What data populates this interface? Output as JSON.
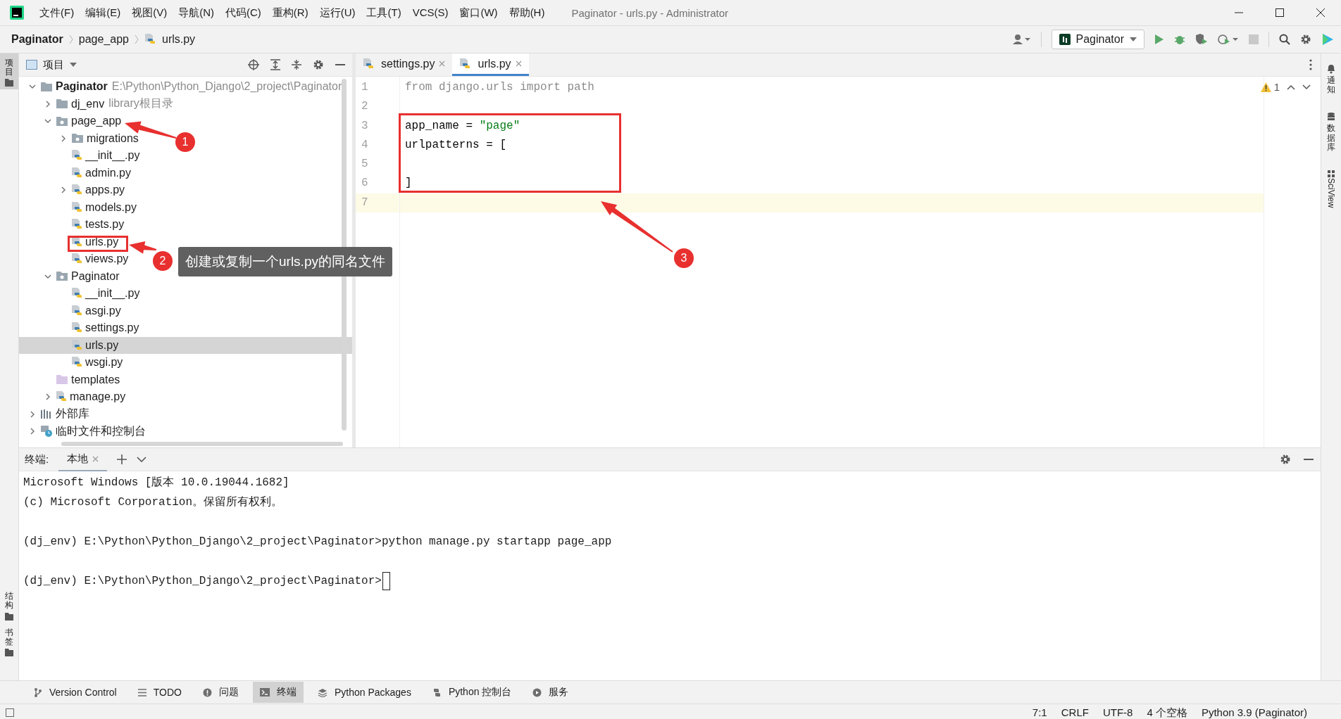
{
  "window": {
    "title": "Paginator - urls.py - Administrator"
  },
  "menu": [
    "文件(F)",
    "编辑(E)",
    "视图(V)",
    "导航(N)",
    "代码(C)",
    "重构(R)",
    "运行(U)",
    "工具(T)",
    "VCS(S)",
    "窗口(W)",
    "帮助(H)"
  ],
  "breadcrumb": [
    {
      "label": "Paginator",
      "kind": "project"
    },
    {
      "label": "page_app",
      "kind": "folder"
    },
    {
      "label": "urls.py",
      "kind": "python"
    }
  ],
  "run_config": {
    "label": "Paginator"
  },
  "left_stripe": [
    {
      "label": "项目",
      "kind": "top",
      "selected": true
    },
    {
      "label": "结构",
      "kind": "bottom",
      "selected": false
    },
    {
      "label": "书签",
      "kind": "bottom",
      "selected": false
    }
  ],
  "right_stripe": [
    {
      "label": "通知",
      "kind": "bell"
    },
    {
      "label": "数据库",
      "kind": "database"
    },
    {
      "label": "SciView",
      "kind": "grid"
    }
  ],
  "project_panel": {
    "title": "项目",
    "tree": [
      {
        "label": "Paginator",
        "kind": "project",
        "hint": "E:\\Python\\Python_Django\\2_project\\Paginator",
        "expanded": true,
        "selected": false,
        "children": [
          {
            "label": "dj_env",
            "kind": "folder",
            "hint": "library根目录",
            "expanded": false,
            "selected": false
          },
          {
            "label": "page_app",
            "kind": "package",
            "expanded": true,
            "selected": false,
            "children": [
              {
                "label": "migrations",
                "kind": "package",
                "expanded": false,
                "selected": false
              },
              {
                "label": "__init__.py",
                "kind": "python",
                "selected": false
              },
              {
                "label": "admin.py",
                "kind": "python",
                "selected": false
              },
              {
                "label": "apps.py",
                "kind": "python",
                "expanded": false,
                "selected": false
              },
              {
                "label": "models.py",
                "kind": "python",
                "selected": false
              },
              {
                "label": "tests.py",
                "kind": "python",
                "selected": false
              },
              {
                "label": "urls.py",
                "kind": "python",
                "selected": false
              },
              {
                "label": "views.py",
                "kind": "python",
                "selected": false
              }
            ]
          },
          {
            "label": "Paginator",
            "kind": "package",
            "expanded": true,
            "selected": false,
            "children": [
              {
                "label": "__init__.py",
                "kind": "python",
                "selected": false
              },
              {
                "label": "asgi.py",
                "kind": "python",
                "selected": false
              },
              {
                "label": "settings.py",
                "kind": "python",
                "selected": false
              },
              {
                "label": "urls.py",
                "kind": "python",
                "selected": true
              },
              {
                "label": "wsgi.py",
                "kind": "python",
                "selected": false
              }
            ]
          },
          {
            "label": "templates",
            "kind": "templates",
            "selected": false
          },
          {
            "label": "manage.py",
            "kind": "python",
            "expanded": false,
            "selected": false
          }
        ]
      },
      {
        "label": "外部库",
        "kind": "library",
        "expanded": false,
        "selected": false
      },
      {
        "label": "临时文件和控制台",
        "kind": "scratch",
        "expanded": false,
        "selected": false
      }
    ]
  },
  "editor": {
    "tabs": [
      {
        "label": "settings.py",
        "selected": false
      },
      {
        "label": "urls.py",
        "selected": true
      }
    ],
    "warnings": "1",
    "lines": [
      {
        "number": "1",
        "current": false,
        "tokens": [
          {
            "text": "from django.urls import path",
            "kind": "unused"
          }
        ]
      },
      {
        "number": "2",
        "current": false
      },
      {
        "number": "3",
        "current": false,
        "tokens": [
          {
            "text": "app_name = ",
            "kind": "plain"
          },
          {
            "text": "\"page\"",
            "kind": "string"
          }
        ]
      },
      {
        "number": "4",
        "current": false,
        "tokens": [
          {
            "text": "urlpatterns = [",
            "kind": "plain"
          }
        ]
      },
      {
        "number": "5",
        "current": false
      },
      {
        "number": "6",
        "current": false,
        "tokens": [
          {
            "text": "]",
            "kind": "plain"
          }
        ]
      },
      {
        "number": "7",
        "current": true
      }
    ]
  },
  "terminal": {
    "title": "终端:",
    "tabs": [
      {
        "label": "本地",
        "selected": true
      }
    ],
    "blocks": [
      {
        "lines": [
          "Microsoft Windows [版本 10.0.19044.1682]",
          "(c) Microsoft Corporation。保留所有权利。"
        ],
        "cursor": false
      },
      {
        "lines": [
          "(dj_env) E:\\Python\\Python_Django\\2_project\\Paginator>python manage.py startapp page_app"
        ],
        "cursor": false
      },
      {
        "lines": [
          "(dj_env) E:\\Python\\Python_Django\\2_project\\Paginator>"
        ],
        "cursor": true
      }
    ]
  },
  "tool_tabs": [
    {
      "label": "Version Control",
      "kind": "vcs",
      "selected": false
    },
    {
      "label": "TODO",
      "kind": "todo",
      "selected": false
    },
    {
      "label": "问题",
      "kind": "problems",
      "selected": false
    },
    {
      "label": "终端",
      "kind": "terminal",
      "selected": true
    },
    {
      "label": "Python Packages",
      "kind": "packages",
      "selected": false
    },
    {
      "label": "Python 控制台",
      "kind": "console",
      "selected": false
    },
    {
      "label": "服务",
      "kind": "services",
      "selected": false
    }
  ],
  "status_bar": [
    "7:1",
    "CRLF",
    "UTF-8",
    "4 个空格",
    "Python 3.9 (Paginator)"
  ],
  "annotations": [
    {
      "number": "1"
    },
    {
      "number": "2"
    },
    {
      "number": "3"
    }
  ],
  "callout": {
    "text": "创建或复制一个urls.py的同名文件"
  }
}
